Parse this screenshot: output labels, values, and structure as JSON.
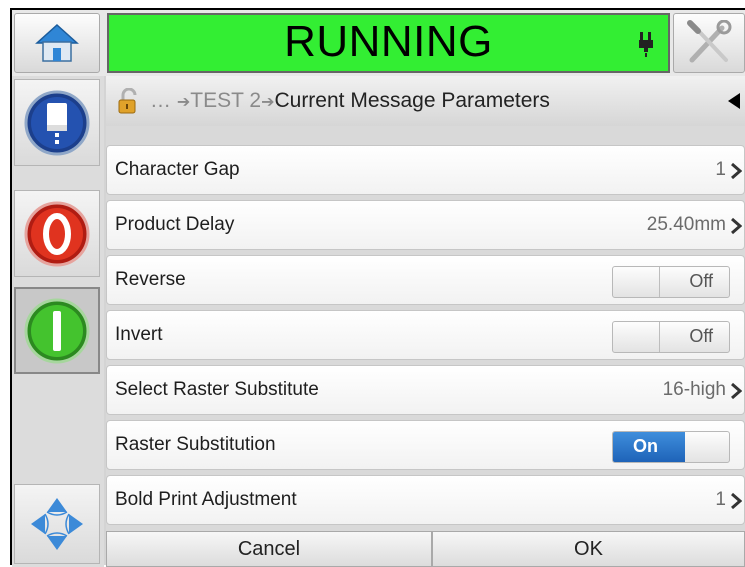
{
  "status": {
    "text": "RUNNING",
    "color": "#33ee33"
  },
  "icons": {
    "home": "home-icon",
    "tools": "tools-icon",
    "ink": "ink-bottle-icon",
    "stop": "stop-icon",
    "start": "start-icon",
    "navigate": "navigation-arrows-icon",
    "lock": "padlock-icon",
    "status": "printhead-icon",
    "back": "back-arrow-icon"
  },
  "breadcrumb": {
    "ellipsis": "…",
    "arrow": "➔",
    "parent": "TEST 2",
    "current": "Current Message Parameters"
  },
  "rows": [
    {
      "label": "Character Gap",
      "value": "1"
    },
    {
      "label": "Product Delay",
      "value": "25.40mm"
    },
    {
      "label": "Reverse",
      "value": "Off"
    },
    {
      "label": "Invert",
      "value": "Off"
    },
    {
      "label": "Select Raster Substitute",
      "value": "16-high"
    },
    {
      "label": "Raster Substitution",
      "value": "On"
    },
    {
      "label": "Bold Print Adjustment",
      "value": "1"
    }
  ],
  "buttons": {
    "cancel": "Cancel",
    "ok": "OK"
  }
}
